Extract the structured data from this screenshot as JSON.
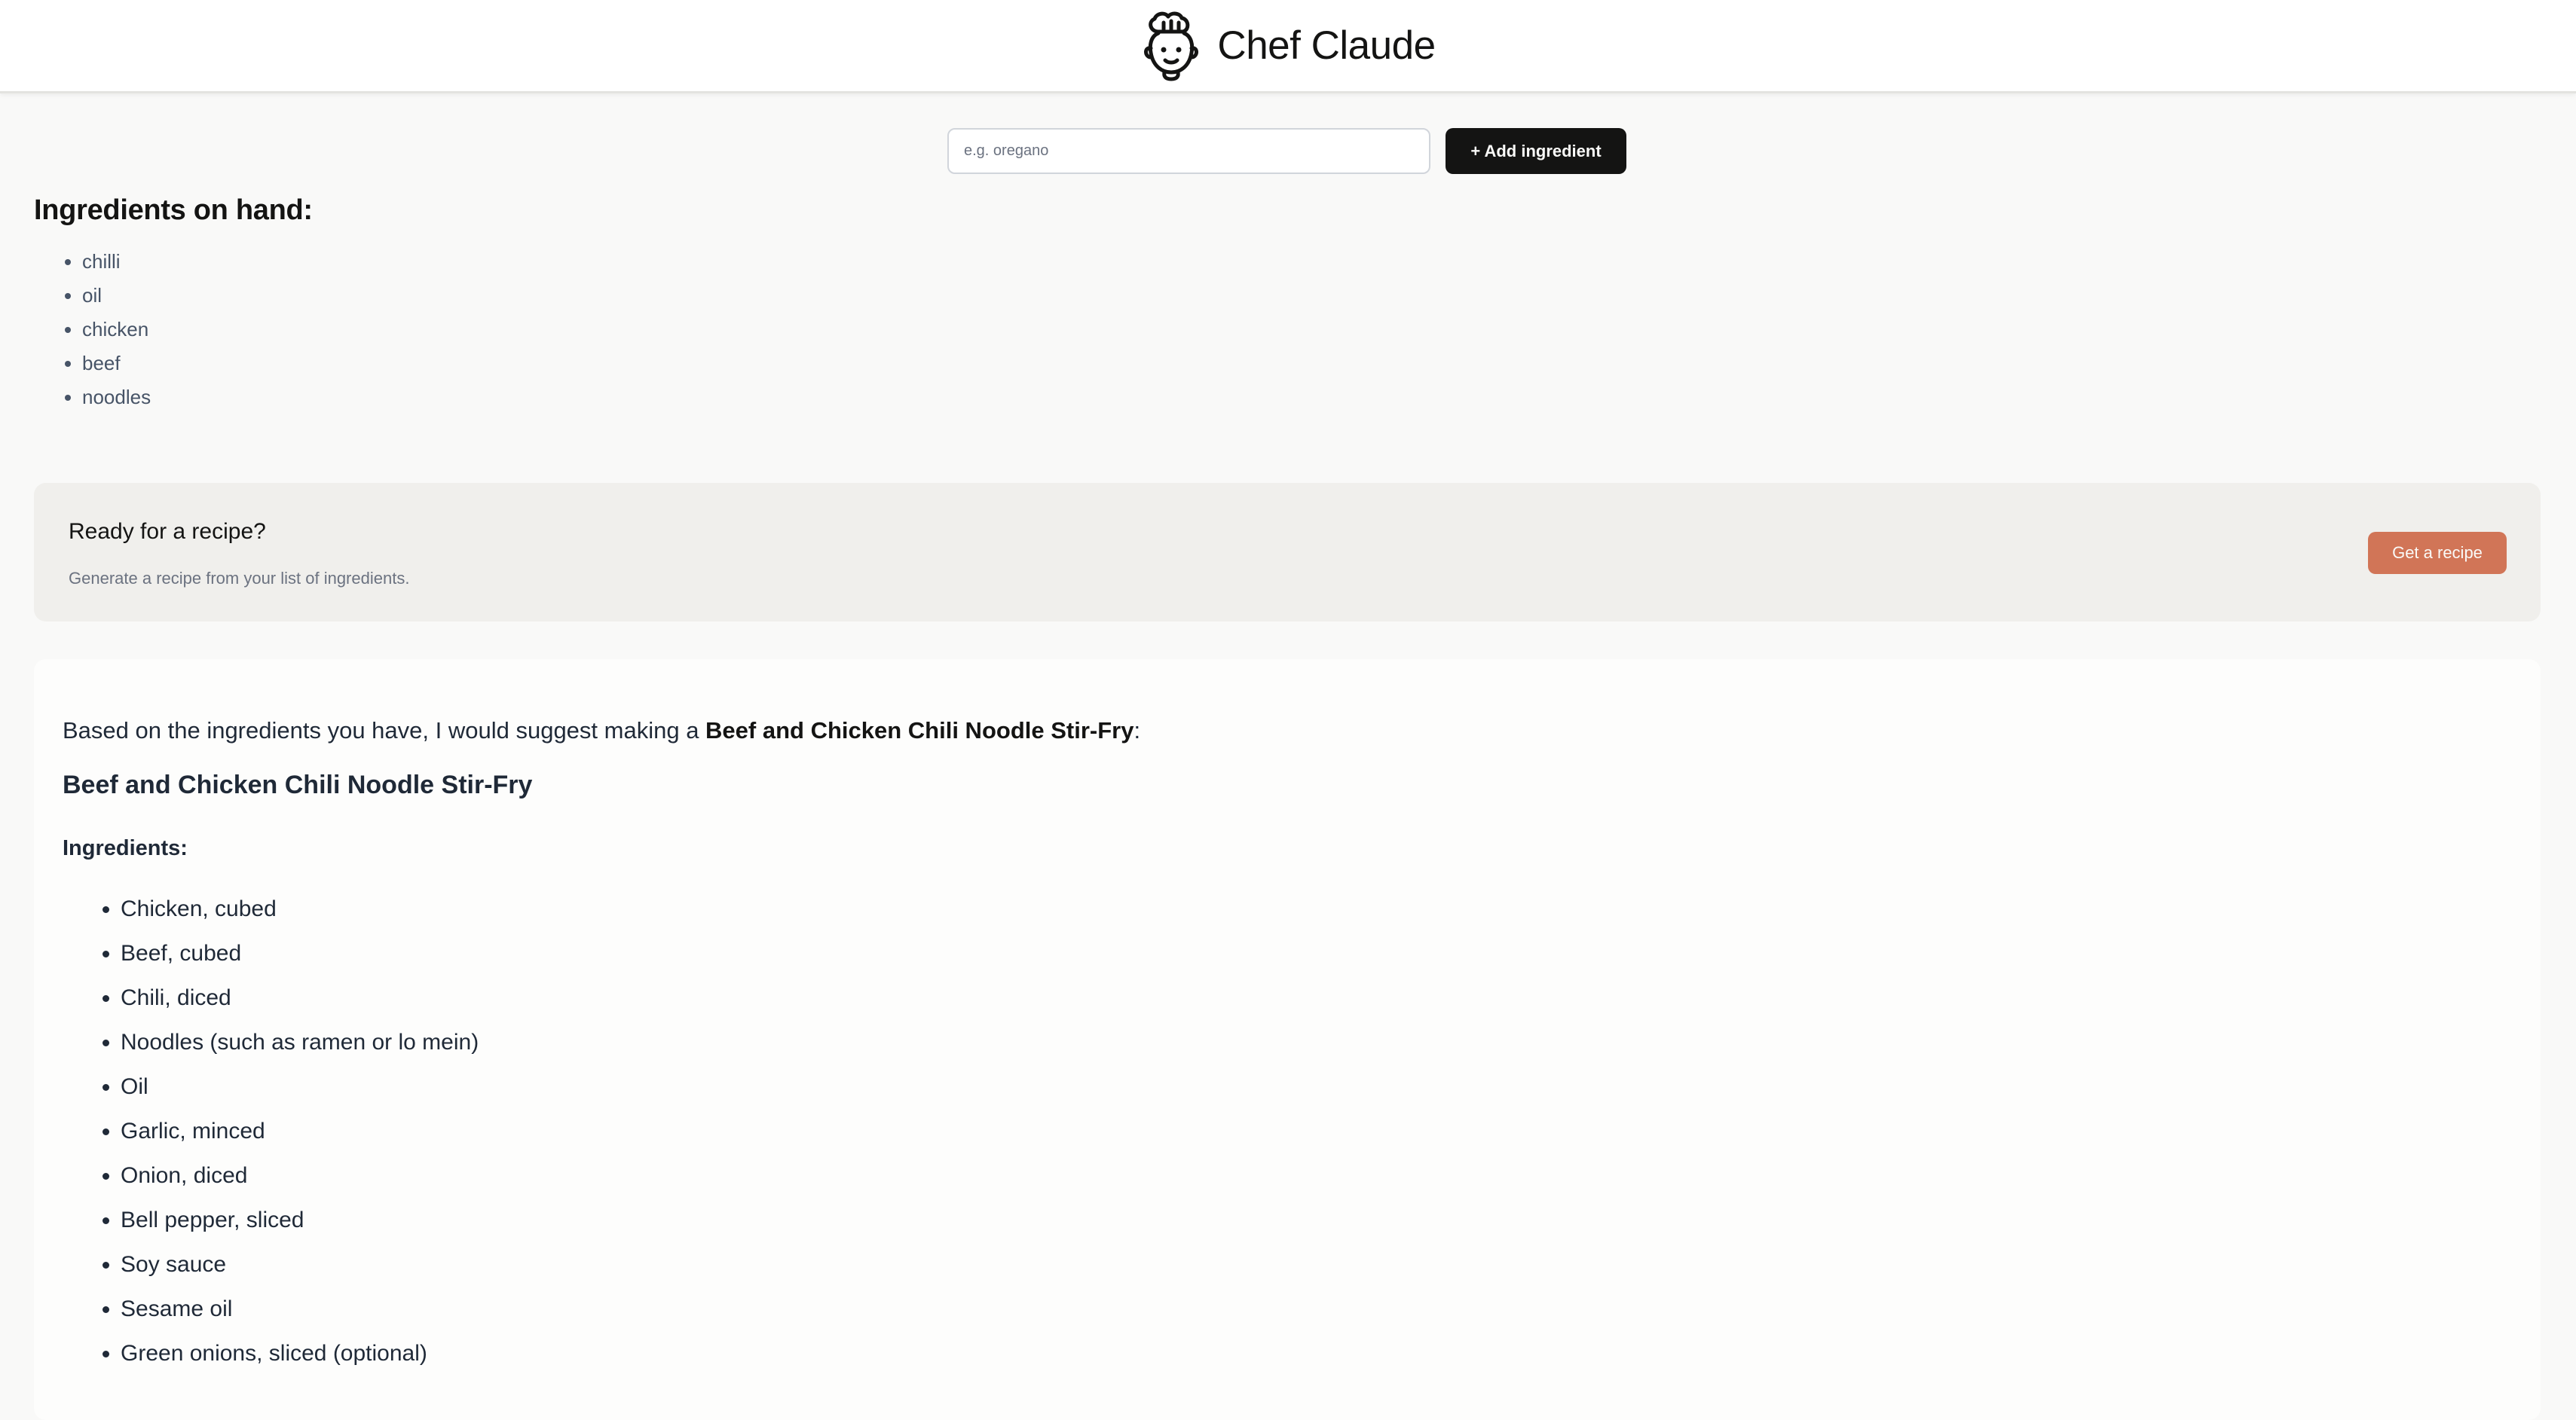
{
  "header": {
    "title": "Chef Claude",
    "logo_icon": "chef-logo-icon"
  },
  "add_form": {
    "placeholder": "e.g. oregano",
    "button_label": "+ Add ingredient"
  },
  "ingredients": {
    "heading": "Ingredients on hand:",
    "items": [
      "chilli",
      "oil",
      "chicken",
      "beef",
      "noodles"
    ]
  },
  "cta": {
    "title": "Ready for a recipe?",
    "description": "Generate a recipe from your list of ingredients.",
    "button_label": "Get a recipe"
  },
  "recipe": {
    "intro_prefix": "Based on the ingredients you have, I would suggest making a ",
    "intro_name": "Beef and Chicken Chili Noodle Stir-Fry",
    "intro_suffix": ":",
    "title": "Beef and Chicken Chili Noodle Stir-Fry",
    "ingredients_heading": "Ingredients:",
    "ingredients": [
      "Chicken, cubed",
      "Beef, cubed",
      "Chili, diced",
      "Noodles (such as ramen or lo mein)",
      "Oil",
      "Garlic, minced",
      "Onion, diced",
      "Bell pepper, sliced",
      "Soy sauce",
      "Sesame oil",
      "Green onions, sliced (optional)"
    ]
  },
  "colors": {
    "accent": "#d17557",
    "primary_button": "#141413",
    "page_background": "#f9f9f8",
    "cta_background": "#f0efec"
  }
}
